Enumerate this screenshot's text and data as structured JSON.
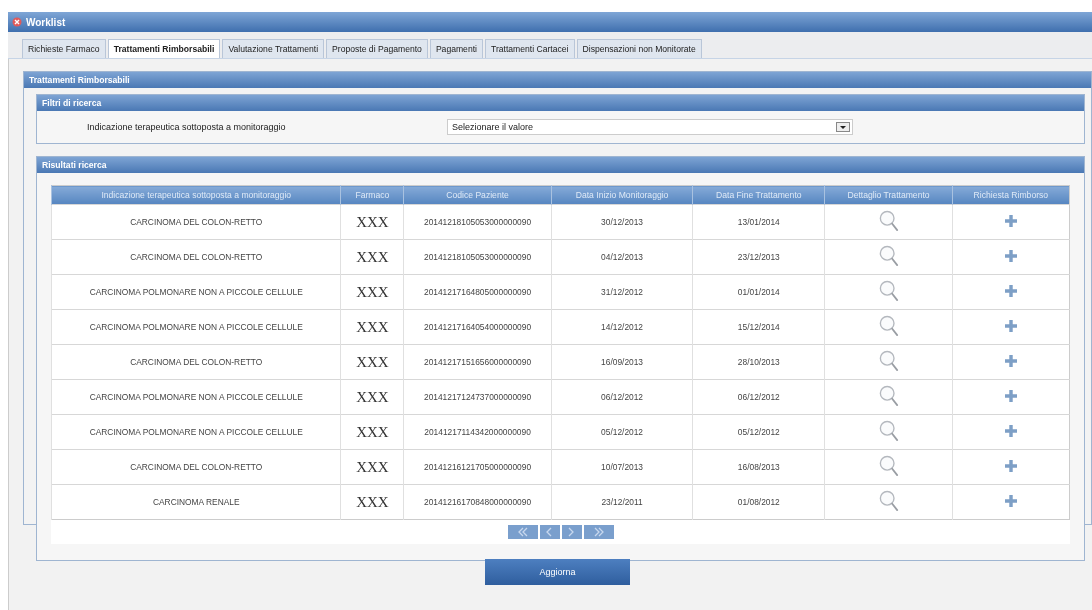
{
  "window": {
    "title": "Worklist"
  },
  "tabs": [
    {
      "label": "Richieste Farmaco",
      "selected": false
    },
    {
      "label": "Trattamenti Rimborsabili",
      "selected": true
    },
    {
      "label": "Valutazione Trattamenti",
      "selected": false
    },
    {
      "label": "Proposte di Pagamento",
      "selected": false
    },
    {
      "label": "Pagamenti",
      "selected": false
    },
    {
      "label": "Trattamenti Cartacei",
      "selected": false
    },
    {
      "label": "Dispensazioni non Monitorate",
      "selected": false
    }
  ],
  "panel": {
    "title": "Trattamenti Rimborsabili"
  },
  "filters": {
    "title": "Filtri di ricerca",
    "label": "Indicazione terapeutica sottoposta a monitoraggio",
    "value": "Selezionare il valore"
  },
  "results": {
    "title": "Risultati ricerca",
    "columns": [
      "Indicazione terapeutica sottoposta a monitoraggio",
      "Farmaco",
      "Codice Paziente",
      "Data Inizio Monitoraggio",
      "Data Fine Trattamento",
      "Dettaglio Trattamento",
      "Richiesta Rimborso"
    ],
    "rows": [
      {
        "indicazione": "CARCINOMA DEL COLON-RETTO",
        "farmaco": "XXX",
        "codice": "20141218105053000000090",
        "inizio": "30/12/2013",
        "fine": "13/01/2014"
      },
      {
        "indicazione": "CARCINOMA DEL COLON-RETTO",
        "farmaco": "XXX",
        "codice": "20141218105053000000090",
        "inizio": "04/12/2013",
        "fine": "23/12/2013"
      },
      {
        "indicazione": "CARCINOMA POLMONARE NON A PICCOLE CELLULE",
        "farmaco": "XXX",
        "codice": "20141217164805000000090",
        "inizio": "31/12/2012",
        "fine": "01/01/2014"
      },
      {
        "indicazione": "CARCINOMA POLMONARE NON A PICCOLE CELLULE",
        "farmaco": "XXX",
        "codice": "20141217164054000000090",
        "inizio": "14/12/2012",
        "fine": "15/12/2014"
      },
      {
        "indicazione": "CARCINOMA DEL COLON-RETTO",
        "farmaco": "XXX",
        "codice": "20141217151656000000090",
        "inizio": "16/09/2013",
        "fine": "28/10/2013"
      },
      {
        "indicazione": "CARCINOMA POLMONARE NON A PICCOLE CELLULE",
        "farmaco": "XXX",
        "codice": "20141217124737000000090",
        "inizio": "06/12/2012",
        "fine": "06/12/2012"
      },
      {
        "indicazione": "CARCINOMA POLMONARE NON A PICCOLE CELLULE",
        "farmaco": "XXX",
        "codice": "20141217114342000000090",
        "inizio": "05/12/2012",
        "fine": "05/12/2012"
      },
      {
        "indicazione": "CARCINOMA DEL COLON-RETTO",
        "farmaco": "XXX",
        "codice": "20141216121705000000090",
        "inizio": "10/07/2013",
        "fine": "16/08/2013"
      },
      {
        "indicazione": "CARCINOMA RENALE",
        "farmaco": "XXX",
        "codice": "20141216170848000000090",
        "inizio": "23/12/2011",
        "fine": "01/08/2012"
      }
    ]
  },
  "pager": [
    {
      "kind": "first"
    },
    {
      "kind": "prev"
    },
    {
      "kind": "next"
    },
    {
      "kind": "last"
    }
  ],
  "buttons": [
    "Aggiorna"
  ]
}
